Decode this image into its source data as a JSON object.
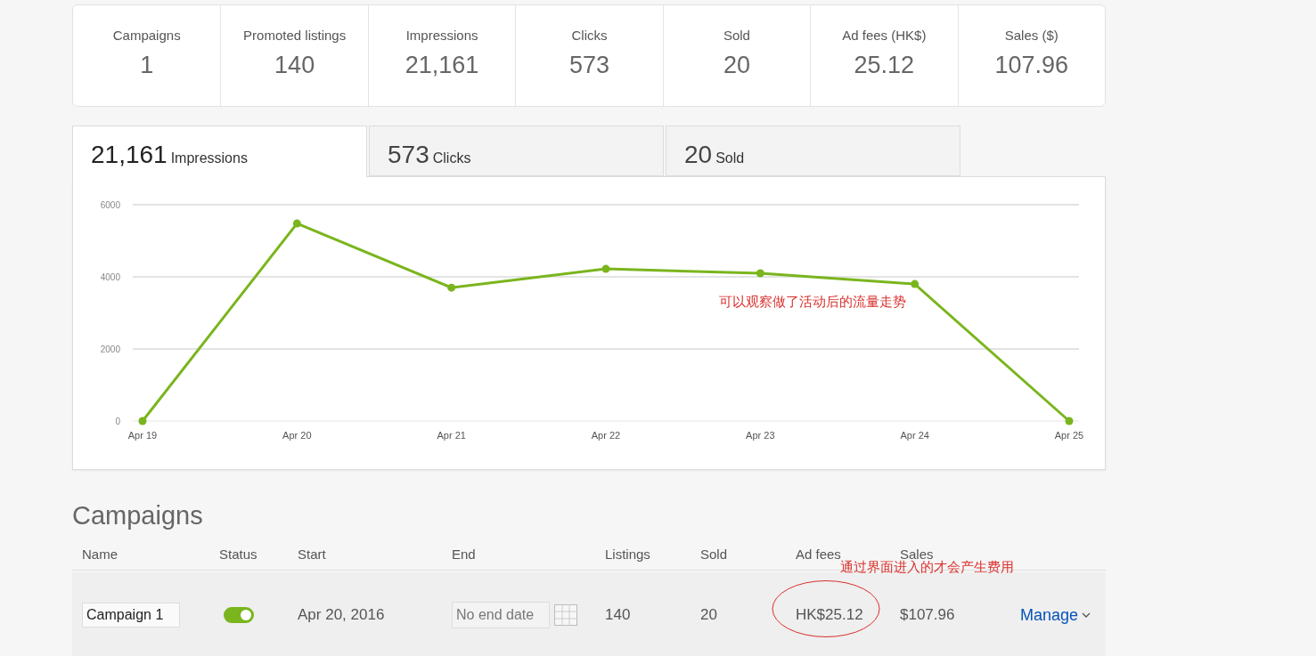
{
  "summary": [
    {
      "label": "Campaigns",
      "value": "1"
    },
    {
      "label": "Promoted listings",
      "value": "140"
    },
    {
      "label": "Impressions",
      "value": "21,161"
    },
    {
      "label": "Clicks",
      "value": "573"
    },
    {
      "label": "Sold",
      "value": "20"
    },
    {
      "label": "Ad fees (HK$)",
      "value": "25.12"
    },
    {
      "label": "Sales ($)",
      "value": "107.96"
    }
  ],
  "metric_tabs": [
    {
      "value": "21,161",
      "label": "Impressions",
      "selected": true
    },
    {
      "value": "573",
      "label": "Clicks",
      "selected": false
    },
    {
      "value": "20",
      "label": "Sold",
      "selected": false
    }
  ],
  "chart": {
    "chart_data": {
      "type": "line",
      "categories": [
        "Apr 19",
        "Apr 20",
        "Apr 21",
        "Apr 22",
        "Apr 23",
        "Apr 24",
        "Apr 25"
      ],
      "ylim": [
        0,
        6000
      ],
      "yticks": [
        0,
        2000,
        4000,
        6000
      ],
      "series": [
        {
          "color": "#7ab51d",
          "marker": true,
          "values": [
            0,
            5480,
            3700,
            4220,
            4100,
            3800,
            0
          ]
        }
      ]
    },
    "note": "可以观察做了活动后的流量走势"
  },
  "campaigns": {
    "title": "Campaigns",
    "columns": [
      "Name",
      "Status",
      "Start",
      "End",
      "Listings",
      "Sold",
      "Ad fees",
      "Sales"
    ],
    "rows": [
      {
        "name": "Campaign 1",
        "on": true,
        "start": "Apr 20, 2016",
        "end_placeholder": "No end date",
        "listings": "140",
        "sold": "20",
        "ad_fees": "HK$25.12",
        "sales": "$107.96",
        "action": "Manage"
      }
    ],
    "note": "通过界面进入的才会产生费用"
  }
}
